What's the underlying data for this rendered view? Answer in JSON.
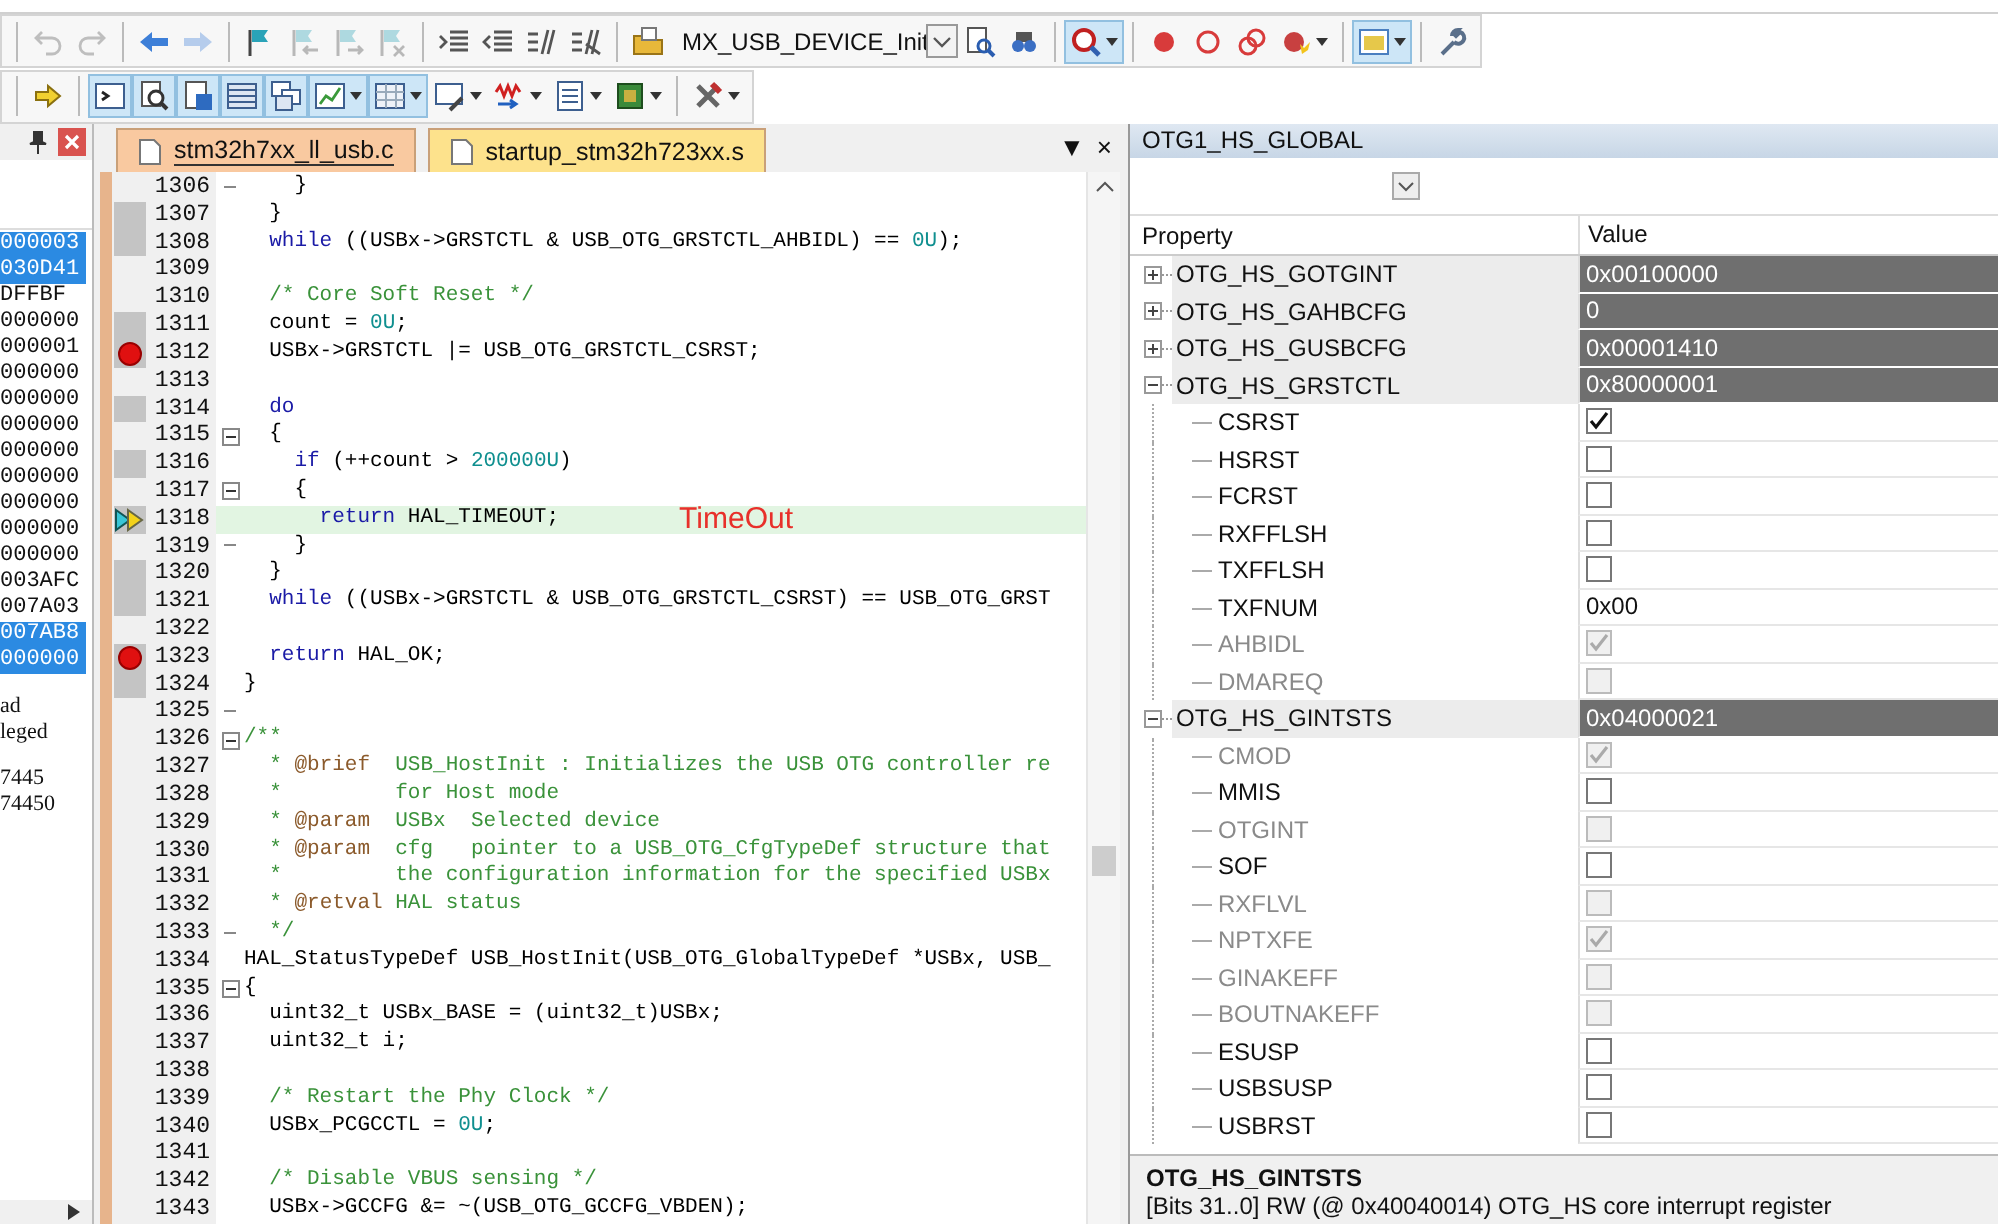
{
  "toolbar_1": [
    {
      "kind": "separator"
    },
    {
      "kind": "button",
      "pressed": false,
      "disabled": true,
      "dropdown": false
    },
    {
      "kind": "button",
      "pressed": false,
      "disabled": true,
      "dropdown": false
    },
    {
      "kind": "separator"
    },
    {
      "kind": "button",
      "pressed": false,
      "disabled": false,
      "dropdown": false
    },
    {
      "kind": "button",
      "pressed": false,
      "disabled": true,
      "dropdown": false
    },
    {
      "kind": "separator"
    },
    {
      "kind": "button",
      "pressed": false,
      "disabled": false,
      "dropdown": false
    },
    {
      "kind": "button",
      "pressed": false,
      "disabled": true,
      "dropdown": false
    },
    {
      "kind": "button",
      "pressed": false,
      "disabled": true,
      "dropdown": false
    },
    {
      "kind": "button",
      "pressed": false,
      "disabled": true,
      "dropdown": false
    },
    {
      "kind": "separator"
    },
    {
      "kind": "button",
      "pressed": false,
      "disabled": false,
      "dropdown": false
    },
    {
      "kind": "button",
      "pressed": false,
      "disabled": false,
      "dropdown": false
    },
    {
      "kind": "button",
      "pressed": false,
      "disabled": false,
      "dropdown": false
    },
    {
      "kind": "button",
      "pressed": false,
      "disabled": false,
      "dropdown": false
    },
    {
      "kind": "separator"
    },
    {
      "kind": "button",
      "pressed": false,
      "disabled": false,
      "dropdown": false
    },
    {
      "kind": "combo",
      "value": "MX_USB_DEVICE_Init"
    },
    {
      "kind": "button",
      "pressed": false,
      "disabled": false,
      "dropdown": false
    },
    {
      "kind": "button",
      "pressed": false,
      "disabled": false,
      "dropdown": false
    },
    {
      "kind": "separator"
    },
    {
      "kind": "button",
      "pressed": true,
      "disabled": false,
      "dropdown": true
    },
    {
      "kind": "separator"
    },
    {
      "kind": "button",
      "pressed": false,
      "disabled": false,
      "dropdown": false
    },
    {
      "kind": "button",
      "pressed": false,
      "disabled": false,
      "dropdown": false
    },
    {
      "kind": "button",
      "pressed": false,
      "disabled": false,
      "dropdown": false
    },
    {
      "kind": "button",
      "pressed": false,
      "disabled": false,
      "dropdown": true
    },
    {
      "kind": "separator"
    },
    {
      "kind": "button",
      "pressed": true,
      "disabled": false,
      "dropdown": true
    },
    {
      "kind": "separator"
    },
    {
      "kind": "button",
      "pressed": false,
      "disabled": false,
      "dropdown": false
    }
  ],
  "toolbar_2": [
    {
      "kind": "separator"
    },
    {
      "kind": "button",
      "pressed": false,
      "disabled": false,
      "dropdown": false
    },
    {
      "kind": "separator"
    },
    {
      "kind": "button",
      "pressed": true,
      "disabled": false,
      "dropdown": false
    },
    {
      "kind": "button",
      "pressed": true,
      "disabled": false,
      "dropdown": false
    },
    {
      "kind": "button",
      "pressed": true,
      "disabled": false,
      "dropdown": false
    },
    {
      "kind": "button",
      "pressed": true,
      "disabled": false,
      "dropdown": false
    },
    {
      "kind": "button",
      "pressed": true,
      "disabled": false,
      "dropdown": false
    },
    {
      "kind": "button",
      "pressed": true,
      "disabled": false,
      "dropdown": true
    },
    {
      "kind": "button",
      "pressed": true,
      "disabled": false,
      "dropdown": true
    },
    {
      "kind": "button",
      "pressed": false,
      "disabled": false,
      "dropdown": true
    },
    {
      "kind": "button",
      "pressed": false,
      "disabled": false,
      "dropdown": true
    },
    {
      "kind": "button",
      "pressed": false,
      "disabled": false,
      "dropdown": true
    },
    {
      "kind": "button",
      "pressed": false,
      "disabled": false,
      "dropdown": true
    },
    {
      "kind": "separator"
    },
    {
      "kind": "button",
      "pressed": false,
      "disabled": false,
      "dropdown": true
    }
  ],
  "memory_panel": {
    "values": [
      {
        "text": "000003",
        "selected": true
      },
      {
        "text": "030D41",
        "selected": true
      },
      {
        "text": "DFFBF",
        "selected": false
      },
      {
        "text": "000000",
        "selected": false
      },
      {
        "text": "000001",
        "selected": false
      },
      {
        "text": "000000",
        "selected": false
      },
      {
        "text": "000000",
        "selected": false
      },
      {
        "text": "000000",
        "selected": false
      },
      {
        "text": "000000",
        "selected": false
      },
      {
        "text": "000000",
        "selected": false
      },
      {
        "text": "000000",
        "selected": false
      },
      {
        "text": "000000",
        "selected": false
      },
      {
        "text": "000000",
        "selected": false
      },
      {
        "text": "003AFC",
        "selected": false
      },
      {
        "text": "007A03",
        "selected": false
      },
      {
        "text": "007AB8",
        "selected": true
      },
      {
        "text": "000000",
        "selected": true
      }
    ],
    "note_groups": [
      {
        "lines": [
          "ad",
          "leged"
        ]
      },
      {
        "lines": [
          "7445",
          "74450"
        ]
      }
    ]
  },
  "editor": {
    "tabs": [
      {
        "label": "stm32h7xx_ll_usb.c",
        "selected": true
      },
      {
        "label": "startup_stm32h723xx.s",
        "selected": false
      }
    ],
    "tab_menu": "▼",
    "tab_close": "×",
    "lines": [
      {
        "n": "1306",
        "code": [
          {
            "text": "    }",
            "kind": "plain"
          }
        ],
        "executed": false,
        "breakpoint": false,
        "current": false,
        "fold_toggle": false,
        "fold_end": true
      },
      {
        "n": "1307",
        "code": [
          {
            "text": "  }",
            "kind": "plain"
          }
        ],
        "executed": true,
        "breakpoint": false,
        "current": false,
        "fold_toggle": false,
        "fold_end": false
      },
      {
        "n": "1308",
        "code": [
          {
            "text": "  while",
            "kind": "keyword"
          },
          {
            "text": " ((USBx->GRSTCTL & USB_OTG_GRSTCTL_AHBIDL) == ",
            "kind": "plain"
          },
          {
            "text": "0U",
            "kind": "number"
          },
          {
            "text": ");",
            "kind": "plain"
          }
        ],
        "executed": true,
        "breakpoint": false,
        "current": false,
        "fold_toggle": false,
        "fold_end": false
      },
      {
        "n": "1309",
        "executed": false,
        "breakpoint": false,
        "current": false,
        "fold_toggle": false,
        "fold_end": false
      },
      {
        "n": "1310",
        "code": [
          {
            "text": "  /* Core Soft Reset */",
            "kind": "comment"
          }
        ],
        "executed": false,
        "breakpoint": false,
        "current": false,
        "fold_toggle": false,
        "fold_end": false
      },
      {
        "n": "1311",
        "code": [
          {
            "text": "  count = ",
            "kind": "plain"
          },
          {
            "text": "0U",
            "kind": "number"
          },
          {
            "text": ";",
            "kind": "plain"
          }
        ],
        "executed": true,
        "breakpoint": false,
        "current": false,
        "fold_toggle": false,
        "fold_end": false
      },
      {
        "n": "1312",
        "code": [
          {
            "text": "  USBx->GRSTCTL |= USB_OTG_GRSTCTL_CSRST;",
            "kind": "plain"
          }
        ],
        "executed": true,
        "breakpoint": true,
        "current": false,
        "fold_toggle": false,
        "fold_end": false
      },
      {
        "n": "1313",
        "executed": false,
        "breakpoint": false,
        "current": false,
        "fold_toggle": false,
        "fold_end": false
      },
      {
        "n": "1314",
        "code": [
          {
            "text": "  do",
            "kind": "keyword"
          }
        ],
        "executed": true,
        "breakpoint": false,
        "current": false,
        "fold_toggle": false,
        "fold_end": false
      },
      {
        "n": "1315",
        "code": [
          {
            "text": "  {",
            "kind": "plain"
          }
        ],
        "executed": false,
        "breakpoint": false,
        "current": false,
        "fold_toggle": true,
        "fold_end": false
      },
      {
        "n": "1316",
        "code": [
          {
            "text": "    if",
            "kind": "keyword"
          },
          {
            "text": " (++count > ",
            "kind": "plain"
          },
          {
            "text": "200000U",
            "kind": "number"
          },
          {
            "text": ")",
            "kind": "plain"
          }
        ],
        "executed": true,
        "breakpoint": false,
        "current": false,
        "fold_toggle": false,
        "fold_end": false
      },
      {
        "n": "1317",
        "code": [
          {
            "text": "    {",
            "kind": "plain"
          }
        ],
        "executed": false,
        "breakpoint": false,
        "current": false,
        "fold_toggle": true,
        "fold_end": false
      },
      {
        "n": "1318",
        "code": [
          {
            "text": "      return",
            "kind": "keyword"
          },
          {
            "text": " HAL_TIMEOUT;",
            "kind": "plain"
          }
        ],
        "executed": true,
        "breakpoint": false,
        "current": true,
        "fold_toggle": false,
        "fold_end": false,
        "annotation": "TimeOut"
      },
      {
        "n": "1319",
        "code": [
          {
            "text": "    }",
            "kind": "plain"
          }
        ],
        "executed": false,
        "breakpoint": false,
        "current": false,
        "fold_toggle": false,
        "fold_end": true
      },
      {
        "n": "1320",
        "code": [
          {
            "text": "  }",
            "kind": "plain"
          }
        ],
        "executed": true,
        "breakpoint": false,
        "current": false,
        "fold_toggle": false,
        "fold_end": false
      },
      {
        "n": "1321",
        "code": [
          {
            "text": "  while",
            "kind": "keyword"
          },
          {
            "text": " ((USBx->GRSTCTL & USB_OTG_GRSTCTL_CSRST) == USB_OTG_GRST",
            "kind": "plain"
          }
        ],
        "executed": true,
        "breakpoint": false,
        "current": false,
        "fold_toggle": false,
        "fold_end": false
      },
      {
        "n": "1322",
        "executed": false,
        "breakpoint": false,
        "current": false,
        "fold_toggle": false,
        "fold_end": false
      },
      {
        "n": "1323",
        "code": [
          {
            "text": "  return",
            "kind": "keyword"
          },
          {
            "text": " HAL_OK;",
            "kind": "plain"
          }
        ],
        "executed": true,
        "breakpoint": true,
        "current": false,
        "fold_toggle": false,
        "fold_end": false
      },
      {
        "n": "1324",
        "code": [
          {
            "text": "}",
            "kind": "plain"
          }
        ],
        "executed": true,
        "breakpoint": false,
        "current": false,
        "fold_toggle": false,
        "fold_end": false
      },
      {
        "n": "1325",
        "executed": false,
        "breakpoint": false,
        "current": false,
        "fold_toggle": false,
        "fold_end": true
      },
      {
        "n": "1326",
        "code": [
          {
            "text": "/**",
            "kind": "comment"
          }
        ],
        "executed": false,
        "breakpoint": false,
        "current": false,
        "fold_toggle": true,
        "fold_end": false
      },
      {
        "n": "1327",
        "code": [
          {
            "text": "  * ",
            "kind": "comment"
          },
          {
            "text": "@brief",
            "kind": "doctag"
          },
          {
            "text": "  USB_HostInit : Initializes the USB OTG controller re",
            "kind": "comment"
          }
        ],
        "executed": false,
        "breakpoint": false,
        "current": false,
        "fold_toggle": false,
        "fold_end": false
      },
      {
        "n": "1328",
        "code": [
          {
            "text": "  *         for Host mode",
            "kind": "comment"
          }
        ],
        "executed": false,
        "breakpoint": false,
        "current": false,
        "fold_toggle": false,
        "fold_end": false
      },
      {
        "n": "1329",
        "code": [
          {
            "text": "  * ",
            "kind": "comment"
          },
          {
            "text": "@param",
            "kind": "doctag"
          },
          {
            "text": "  USBx  Selected device",
            "kind": "comment"
          }
        ],
        "executed": false,
        "breakpoint": false,
        "current": false,
        "fold_toggle": false,
        "fold_end": false
      },
      {
        "n": "1330",
        "code": [
          {
            "text": "  * ",
            "kind": "comment"
          },
          {
            "text": "@param",
            "kind": "doctag"
          },
          {
            "text": "  cfg   pointer to a USB_OTG_CfgTypeDef structure that",
            "kind": "comment"
          }
        ],
        "executed": false,
        "breakpoint": false,
        "current": false,
        "fold_toggle": false,
        "fold_end": false
      },
      {
        "n": "1331",
        "code": [
          {
            "text": "  *         the configuration information for the specified USBx",
            "kind": "comment"
          }
        ],
        "executed": false,
        "breakpoint": false,
        "current": false,
        "fold_toggle": false,
        "fold_end": false
      },
      {
        "n": "1332",
        "code": [
          {
            "text": "  * ",
            "kind": "comment"
          },
          {
            "text": "@retval",
            "kind": "doctag"
          },
          {
            "text": " HAL status",
            "kind": "comment"
          }
        ],
        "executed": false,
        "breakpoint": false,
        "current": false,
        "fold_toggle": false,
        "fold_end": false
      },
      {
        "n": "1333",
        "code": [
          {
            "text": "  */",
            "kind": "comment"
          }
        ],
        "executed": false,
        "breakpoint": false,
        "current": false,
        "fold_toggle": false,
        "fold_end": true
      },
      {
        "n": "1334",
        "code": [
          {
            "text": "HAL_StatusTypeDef USB_HostInit(USB_OTG_GlobalTypeDef *USBx, USB_",
            "kind": "plain"
          }
        ],
        "executed": false,
        "breakpoint": false,
        "current": false,
        "fold_toggle": false,
        "fold_end": false
      },
      {
        "n": "1335",
        "code": [
          {
            "text": "{",
            "kind": "plain"
          }
        ],
        "executed": false,
        "breakpoint": false,
        "current": false,
        "fold_toggle": true,
        "fold_end": false
      },
      {
        "n": "1336",
        "code": [
          {
            "text": "  uint32_t USBx_BASE = (uint32_t)USBx;",
            "kind": "plain"
          }
        ],
        "executed": false,
        "breakpoint": false,
        "current": false,
        "fold_toggle": false,
        "fold_end": false
      },
      {
        "n": "1337",
        "code": [
          {
            "text": "  uint32_t i;",
            "kind": "plain"
          }
        ],
        "executed": false,
        "breakpoint": false,
        "current": false,
        "fold_toggle": false,
        "fold_end": false
      },
      {
        "n": "1338",
        "executed": false,
        "breakpoint": false,
        "current": false,
        "fold_toggle": false,
        "fold_end": false
      },
      {
        "n": "1339",
        "code": [
          {
            "text": "  /* Restart the Phy Clock */",
            "kind": "comment"
          }
        ],
        "executed": false,
        "breakpoint": false,
        "current": false,
        "fold_toggle": false,
        "fold_end": false
      },
      {
        "n": "1340",
        "code": [
          {
            "text": "  USBx_PCGCCTL = ",
            "kind": "plain"
          },
          {
            "text": "0U",
            "kind": "number"
          },
          {
            "text": ";",
            "kind": "plain"
          }
        ],
        "executed": false,
        "breakpoint": false,
        "current": false,
        "fold_toggle": false,
        "fold_end": false
      },
      {
        "n": "1341",
        "executed": false,
        "breakpoint": false,
        "current": false,
        "fold_toggle": false,
        "fold_end": false
      },
      {
        "n": "1342",
        "code": [
          {
            "text": "  /* Disable VBUS sensing */",
            "kind": "comment"
          }
        ],
        "executed": false,
        "breakpoint": false,
        "current": false,
        "fold_toggle": false,
        "fold_end": false
      },
      {
        "n": "1343",
        "code": [
          {
            "text": "  USBx->GCCFG &= ~(USB_OTG_GCCFG_VBDEN);",
            "kind": "plain"
          }
        ],
        "executed": false,
        "breakpoint": false,
        "current": false,
        "fold_toggle": false,
        "fold_end": false
      }
    ]
  },
  "right_panel": {
    "title": "OTG1_HS_GLOBAL",
    "columns": [
      "Property",
      "Value"
    ],
    "registers": [
      {
        "name": "OTG_HS_GOTGINT",
        "value": "0x00100000",
        "expanded": false
      },
      {
        "name": "OTG_HS_GAHBCFG",
        "value": "0",
        "expanded": false
      },
      {
        "name": "OTG_HS_GUSBCFG",
        "value": "0x00001410",
        "expanded": false
      },
      {
        "name": "OTG_HS_GRSTCTL",
        "value": "0x80000001",
        "expanded": true,
        "fields": [
          {
            "name": "CSRST",
            "kind": "check",
            "checked": true,
            "disabled": false
          },
          {
            "name": "HSRST",
            "kind": "check",
            "checked": false,
            "disabled": false
          },
          {
            "name": "FCRST",
            "kind": "check",
            "checked": false,
            "disabled": false
          },
          {
            "name": "RXFFLSH",
            "kind": "check",
            "checked": false,
            "disabled": false
          },
          {
            "name": "TXFFLSH",
            "kind": "check",
            "checked": false,
            "disabled": false
          },
          {
            "name": "TXFNUM",
            "kind": "text",
            "value": "0x00",
            "disabled": false
          },
          {
            "name": "AHBIDL",
            "kind": "check",
            "checked": true,
            "disabled": true
          },
          {
            "name": "DMAREQ",
            "kind": "check",
            "checked": false,
            "disabled": true
          }
        ]
      },
      {
        "name": "OTG_HS_GINTSTS",
        "value": "0x04000021",
        "expanded": true,
        "fields": [
          {
            "name": "CMOD",
            "kind": "check",
            "checked": true,
            "disabled": true
          },
          {
            "name": "MMIS",
            "kind": "check",
            "checked": false,
            "disabled": false
          },
          {
            "name": "OTGINT",
            "kind": "check",
            "checked": false,
            "disabled": true
          },
          {
            "name": "SOF",
            "kind": "check",
            "checked": false,
            "disabled": false
          },
          {
            "name": "RXFLVL",
            "kind": "check",
            "checked": false,
            "disabled": true
          },
          {
            "name": "NPTXFE",
            "kind": "check",
            "checked": true,
            "disabled": true
          },
          {
            "name": "GINAKEFF",
            "kind": "check",
            "checked": false,
            "disabled": true
          },
          {
            "name": "BOUTNAKEFF",
            "kind": "check",
            "checked": false,
            "disabled": true
          },
          {
            "name": "ESUSP",
            "kind": "check",
            "checked": false,
            "disabled": false
          },
          {
            "name": "USBSUSP",
            "kind": "check",
            "checked": false,
            "disabled": false
          },
          {
            "name": "USBRST",
            "kind": "check",
            "checked": false,
            "disabled": false
          }
        ]
      }
    ],
    "info": {
      "title": "OTG_HS_GINTSTS",
      "description": "[Bits 31..0] RW (@ 0x40040014) OTG_HS core interrupt register"
    }
  }
}
